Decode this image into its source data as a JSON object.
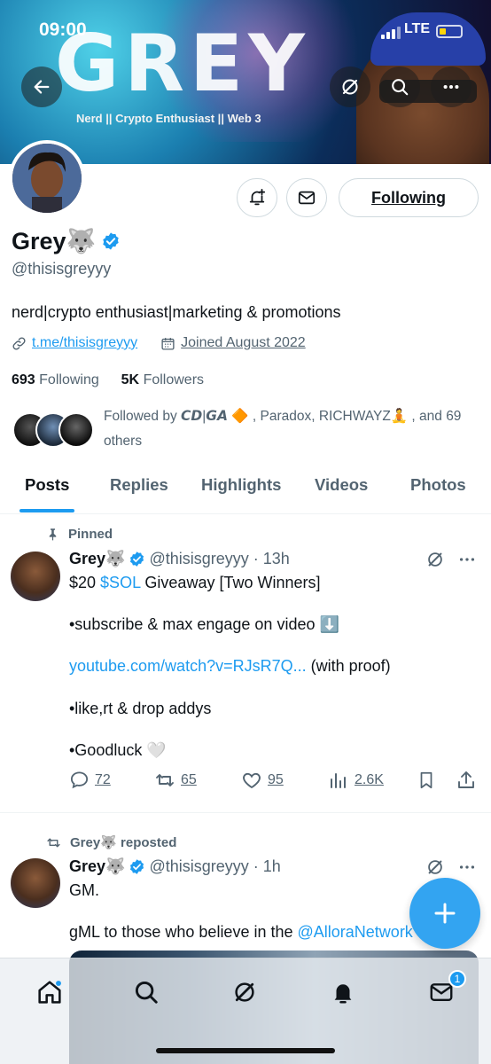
{
  "status": {
    "time": "09:00",
    "network": "LTE"
  },
  "banner": {
    "title": "GREY",
    "subtitle": "Nerd || Crypto Enthusiast || Web 3"
  },
  "profile": {
    "name": "Grey🐺",
    "handle": "@thisisgreyyy",
    "bio": "nerd|crypto enthusiast|marketing & promotions",
    "link": "t.me/thisisgreyyy",
    "joined": "Joined August 2022",
    "following_count": "693",
    "following_label": "Following",
    "followers_count": "5K",
    "followers_label": "Followers",
    "followed_by": "Followed by 𝘾𝘿|𝙂𝘼 🔶 , Paradox, RICHWAYZ🧘 , and 69 others",
    "follow_button": "Following"
  },
  "tabs": [
    "Posts",
    "Replies",
    "Highlights",
    "Videos",
    "Photos"
  ],
  "posts": [
    {
      "context": "Pinned",
      "author": "Grey🐺",
      "handle": "@thisisgreyyy · 13h",
      "line1_prefix": "$20 ",
      "line1_cashtag": "$SOL",
      "line1_suffix": " Giveaway [Two Winners]",
      "line2": "•subscribe & max engage on video ⬇️",
      "line3_link": "youtube.com/watch?v=RJsR7Q...",
      "line3_suffix": " (with proof)",
      "line4": "•like,rt & drop addys",
      "line5": "•Goodluck 🤍",
      "replies": "72",
      "reposts": "65",
      "likes": "95",
      "views": "2.6K"
    },
    {
      "context": "Grey🐺 reposted",
      "author": "Grey🐺",
      "handle": "@thisisgreyyy · 1h",
      "line1": "GM.",
      "line2_prefix": "gML to those who believe in the ",
      "line2_mention": "@AlloraNetwork"
    }
  ],
  "nav": {
    "messages_badge": "1"
  },
  "colors": {
    "accent": "#1d9bf0",
    "text": "#0f1419",
    "muted": "#536471"
  }
}
